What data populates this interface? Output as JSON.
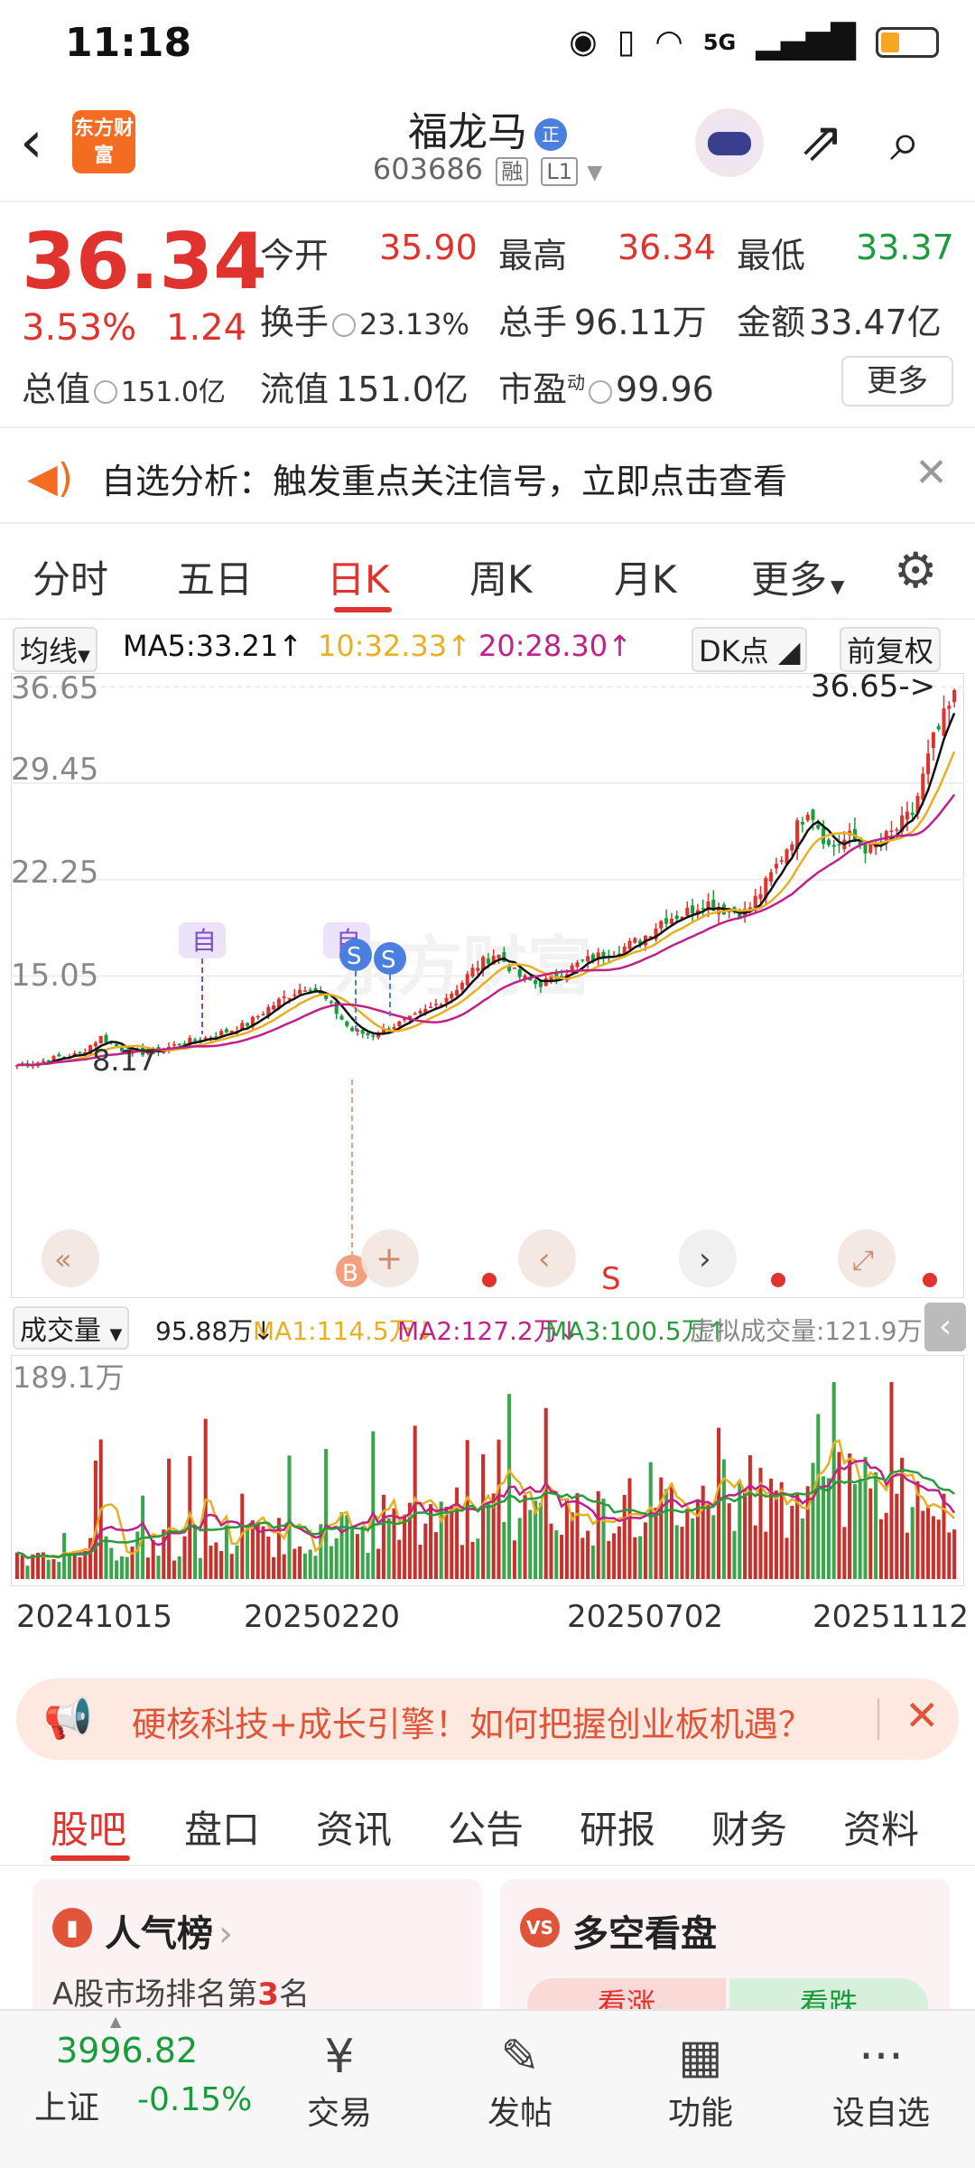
{
  "status": {
    "time": "11:18",
    "network": "5G"
  },
  "header": {
    "logo_text": "东方财富",
    "stock_name": "福龙马",
    "name_badge": "正",
    "stock_code": "603686",
    "tag_margin": "融",
    "tag_level": "L1"
  },
  "quote": {
    "price": "36.34",
    "change_pct": "3.53%",
    "change_abs": "1.24",
    "open_label": "今开",
    "open": "35.90",
    "high_label": "最高",
    "high": "36.34",
    "low_label": "最低",
    "low": "33.37",
    "turnover_label": "换手",
    "turnover": "23.13%",
    "volume_label": "总手",
    "volume": "96.11万",
    "amount_label": "金额",
    "amount": "33.47亿",
    "mktcap_label": "总值",
    "mktcap": "151.0亿",
    "float_label": "流值",
    "float": "151.0亿",
    "pe_label": "市盈",
    "pe_sup": "动",
    "pe": "99.96",
    "more_label": "更多"
  },
  "notice": {
    "text": "自选分析：触发重点关注信号，立即点击查看"
  },
  "ktabs": [
    "分时",
    "五日",
    "日K",
    "周K",
    "月K",
    "更多"
  ],
  "ma": {
    "selector": "均线",
    "ma5": "MA5:33.21",
    "ma10": "10:32.33",
    "ma20": "20:28.30",
    "dk": "DK点",
    "adjust": "前复权"
  },
  "chart_data": {
    "type": "candlestick",
    "price_axis_labels": [
      "36.65",
      "29.45",
      "22.25",
      "15.05"
    ],
    "max_marker": "36.65->",
    "min_marker": "8.17",
    "ylim": [
      8.0,
      37.0
    ],
    "markers": [
      "自",
      "自",
      "S",
      "S",
      "B"
    ],
    "colors": {
      "up": "#e0332d",
      "down": "#1a9b3c",
      "ma5": "#111111",
      "ma10": "#e8b020",
      "ma20": "#c0208a"
    },
    "approx_close": [
      8.4,
      8.6,
      9.0,
      9.2,
      10.5,
      9.6,
      9.3,
      9.6,
      10.1,
      10.4,
      10.9,
      11.4,
      12.6,
      13.6,
      14.4,
      13.0,
      11.0,
      10.6,
      11.3,
      11.9,
      12.8,
      14.0,
      15.7,
      16.8,
      15.1,
      14.4,
      15.1,
      16.0,
      16.6,
      17.1,
      17.8,
      19.3,
      19.7,
      20.6,
      20.0,
      19.8,
      22.0,
      24.8,
      27.8,
      24.6,
      25.4,
      24.4,
      25.7,
      27.2,
      32.6,
      35.8
    ]
  },
  "volume": {
    "selector": "成交量",
    "vol": "95.88万",
    "ma1": "MA1:114.5万",
    "ma2": "MA2:127.2万",
    "ma3": "MA3:100.5万",
    "virtual": "虚拟成交量:121.9万",
    "axis_max": "189.1万",
    "dates": [
      "20241015",
      "20250220",
      "20250702",
      "20251112"
    ]
  },
  "banner": {
    "text": "硬核科技+成长引擎！如何把握创业板机遇？"
  },
  "ltabs": [
    "股吧",
    "盘口",
    "资讯",
    "公告",
    "研报",
    "财务",
    "资料"
  ],
  "cards": [
    {
      "icon": "▮",
      "title": "人气榜",
      "sub_prefix": "A股市场排名第",
      "rank": "3",
      "sub_suffix": "名"
    },
    {
      "icon": "VS",
      "title": "多空看盘",
      "bull": "看涨",
      "bear": "看跌"
    }
  ],
  "bottom": {
    "index_value": "3996.82",
    "index_name": "上证",
    "index_change": "-0.15%",
    "nav": [
      {
        "icon": "¥",
        "label": "交易"
      },
      {
        "icon": "✎",
        "label": "发帖"
      },
      {
        "icon": "▦",
        "label": "功能"
      },
      {
        "icon": "···",
        "label": "设自选"
      }
    ]
  }
}
